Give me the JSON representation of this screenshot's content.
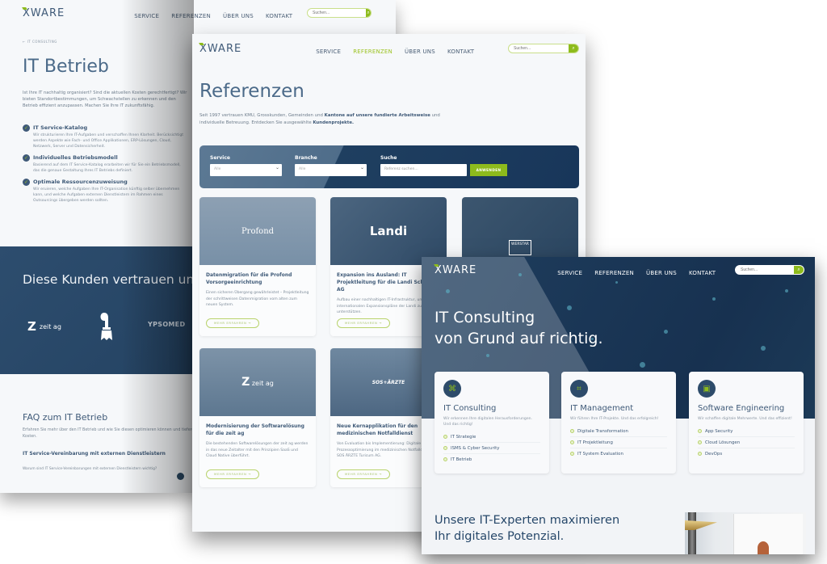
{
  "brand": {
    "logo_text": "XWARE",
    "accent_color": "#8dbb1c",
    "primary_color": "#3f5a78",
    "dark_blue": "#1f3d5c"
  },
  "nav": {
    "items": [
      "SERVICE",
      "REFERENZEN",
      "ÜBER UNS",
      "KONTAKT"
    ],
    "search_placeholder": "Suchen...",
    "search_icon": "magnifier-icon"
  },
  "page_it_betrieb": {
    "breadcrumb": "← IT CONSULTING",
    "title": "IT Betrieb",
    "intro": "Ist Ihre IT nachhaltig organisiert? Sind die aktuellen Kosten gerechtfertigt? Wir bieten Standortbestimmungen, um Schwachstellen zu erkennen und den Betrieb effizient anzupassen. Machen Sie Ihre IT zukunftsfähig.",
    "features": [
      {
        "title": "IT Service-Katalog",
        "text": "Wir strukturieren Ihre IT-Aufgaben und verschaffen Ihnen Klarheit. Berücksichtigt werden Aspekte wie Fach- und Office Applikationen, ERP-Lösungen, Cloud, Netzwerk, Server und Datensicherheit."
      },
      {
        "title": "Individuelles Betriebsmodell",
        "text": "Basierend auf dem IT Service-Katalog erarbeiten wir für Sie ein Betriebsmodell, das die genaue Gestaltung Ihres IT Betriebs definiert."
      },
      {
        "title": "Optimale Ressourcenzuweisung",
        "text": "Wir eruieren, welche Aufgaben Ihre IT-Organisation künftig selber übernehmen kann, und welche Aufgaben externen Dienstleistern im Rahmen eines Outsourcings übergeben werden sollten."
      }
    ],
    "clients_heading": "Diese Kunden vertrauen uns",
    "clients": [
      "zeit ag",
      "Basel-Stadt",
      "YPSOMED"
    ],
    "faq": {
      "title": "FAQ zum IT Betrieb",
      "lead": "Erfahren Sie mehr über den IT Betrieb und wie Sie diesen optimieren können und tiefere Kosten.",
      "question_title": "IT Service-Vereinbarung mit externen Dienstleistern",
      "question": "Warum sind IT Service-Vereinbarungen mit externen Dienstleistern wichtig?"
    }
  },
  "page_referenzen": {
    "title": "Referenzen",
    "intro_plain_1": "Seit 1997 vertrauen KMU, Grosskunden, Gemeinden und ",
    "intro_bold_1": "Kantone auf unsere fundierte Arbeitsweise",
    "intro_plain_2": " und individuelle Betreuung. Entdecken Sie ausgewählte ",
    "intro_bold_2": "Kundenprojekte.",
    "filter": {
      "service_label": "Service",
      "service_value": "Alle",
      "branche_label": "Branche",
      "branche_value": "Alle",
      "suche_label": "Suche",
      "suche_placeholder": "Referenz suchen...",
      "apply_label": "ANWENDEN"
    },
    "more_label": "MEHR ERFAHREN →",
    "cards": [
      {
        "logo": "Profond",
        "title": "Datenmigration für die Profond Vorsorgeeinrichtung",
        "text": "Einen sicheren Übergang gewährleistet – Projektleitung der schrittweisen Datenmigration vom alten zum neuen System."
      },
      {
        "logo": "Landi",
        "title": "Expansion ins Ausland: IT Projektleitung für die Landi Schweiz AG",
        "text": "Aufbau einer nachhaltigen IT-Infrastruktur, um die internationalen Expansionspläne der Landi zu unterstützen."
      },
      {
        "logo": "WERSTAR",
        "title": "",
        "text": ""
      },
      {
        "logo": "zeit ag",
        "title": "Modernisierung der Softwarelösung für die zeit ag",
        "text": "Die bestehenden Softwarelösungen der zeit ag werden in das neue Zeitalter mit den Prinzipien SaaS und Cloud Native überführt."
      },
      {
        "logo": "SOS+ÄRZTE",
        "title": "Neue Kernapplikation für den medizinischen Notfalldienst",
        "text": "Von Evaluation bis Implementierung: Digitale Prozessoptimierung im medizinischen Notfalldienst von SOS ÄRZTE Turicum AG."
      }
    ]
  },
  "page_it_consulting": {
    "hero_line_1": "IT Consulting",
    "hero_line_2": "von Grund auf richtig.",
    "services": [
      {
        "title": "IT Consulting",
        "text": "Wir erkennen Ihre digitalen Herausforderungen. Und das richtig!",
        "items": [
          "IT Strategie",
          "ISMS & Cyber Security",
          "IT Betrieb"
        ]
      },
      {
        "title": "IT Management",
        "text": "Wir führen Ihre IT-Projekte. Und das erfolgreich!",
        "items": [
          "Digitale Transformation",
          "IT Projektleitung",
          "IT System Evaluation"
        ]
      },
      {
        "title": "Software Engineering",
        "text": "Wir schaffen digitale Mehrwerte. Und das effizient!",
        "items": [
          "App Security",
          "Cloud Lösungen",
          "DevOps"
        ]
      }
    ],
    "bottom_line_1": "Unsere IT-Experten maximieren",
    "bottom_line_2": "Ihr digitales Potenzial."
  }
}
